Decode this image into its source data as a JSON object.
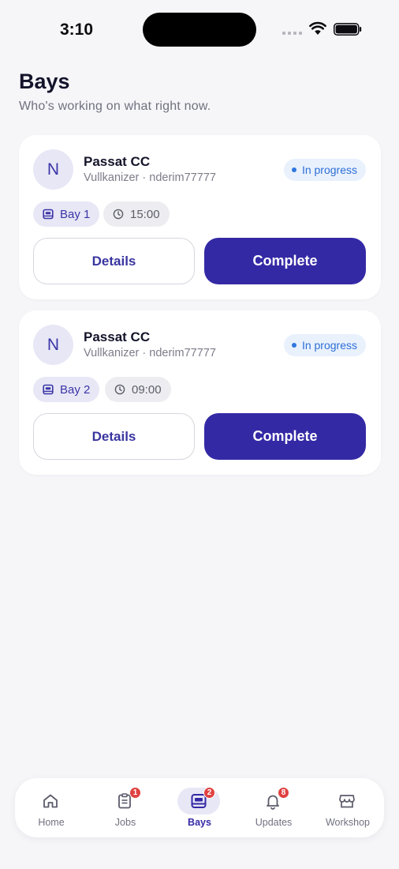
{
  "status_bar": {
    "time": "3:10"
  },
  "header": {
    "title": "Bays",
    "subtitle": "Who's working on what right now."
  },
  "cards": [
    {
      "avatar_initial": "N",
      "title": "Passat CC",
      "meta": "Vullkanizer · nderim77777",
      "status": "In progress",
      "bay": "Bay 1",
      "time": "15:00",
      "details_label": "Details",
      "complete_label": "Complete"
    },
    {
      "avatar_initial": "N",
      "title": "Passat CC",
      "meta": "Vullkanizer · nderim77777",
      "status": "In progress",
      "bay": "Bay 2",
      "time": "09:00",
      "details_label": "Details",
      "complete_label": "Complete"
    }
  ],
  "tabs": [
    {
      "label": "Home",
      "icon": "home-icon",
      "badge": null,
      "active": false
    },
    {
      "label": "Jobs",
      "icon": "clipboard-icon",
      "badge": "1",
      "active": false
    },
    {
      "label": "Bays",
      "icon": "bay-icon",
      "badge": "2",
      "active": true
    },
    {
      "label": "Updates",
      "icon": "bell-icon",
      "badge": "8",
      "active": false
    },
    {
      "label": "Workshop",
      "icon": "store-icon",
      "badge": null,
      "active": false
    }
  ],
  "colors": {
    "accent": "#3429a5",
    "status_blue": "#2d6fd6",
    "badge_red": "#e04141",
    "background": "#f6f6f9"
  }
}
